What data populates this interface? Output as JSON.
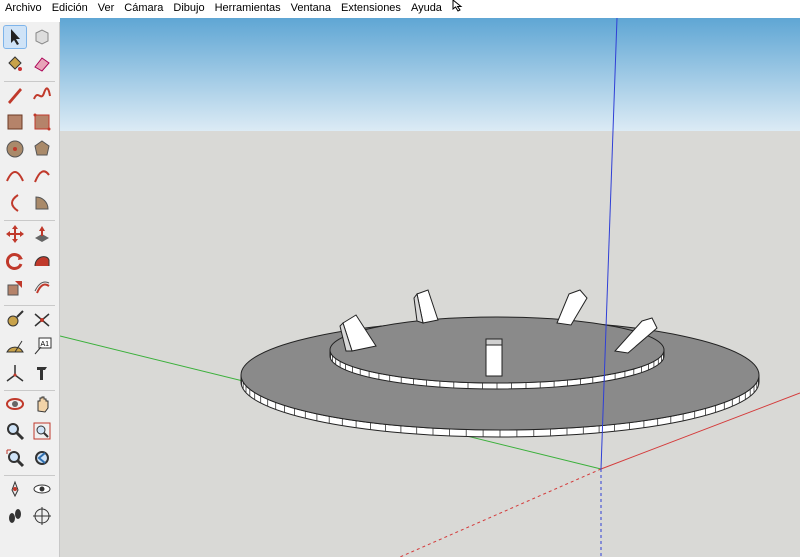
{
  "menu": [
    "Archivo",
    "Edición",
    "Ver",
    "Cámara",
    "Dibujo",
    "Herramientas",
    "Ventana",
    "Extensiones",
    "Ayuda"
  ],
  "colors": {
    "sky_top": "#5fa6d4",
    "sky_bottom": "#dcebf5",
    "ground": "#d9d9d6",
    "axis_red": "#d43b3b",
    "axis_green": "#3bb03b",
    "axis_blue": "#2f3fd6",
    "disc_face": "#8a8a8a",
    "disc_edge": "#ffffff"
  },
  "tools": [
    {
      "name": "select-tool-icon",
      "active": true
    },
    {
      "name": "component-tool-icon"
    },
    {
      "name": "paint-bucket-icon"
    },
    {
      "name": "eraser-icon"
    },
    {
      "name": "pencil-line-icon"
    },
    {
      "name": "freehand-icon"
    },
    {
      "name": "rectangle-icon"
    },
    {
      "name": "rotated-rectangle-icon"
    },
    {
      "name": "circle-icon"
    },
    {
      "name": "polygon-icon"
    },
    {
      "name": "arc-icon"
    },
    {
      "name": "two-point-arc-icon"
    },
    {
      "name": "three-point-arc-icon"
    },
    {
      "name": "pie-icon"
    },
    {
      "name": "move-icon"
    },
    {
      "name": "push-pull-icon"
    },
    {
      "name": "rotate-icon"
    },
    {
      "name": "follow-me-icon"
    },
    {
      "name": "scale-icon"
    },
    {
      "name": "offset-icon"
    },
    {
      "name": "tape-measure-icon"
    },
    {
      "name": "dimension-icon"
    },
    {
      "name": "protractor-icon"
    },
    {
      "name": "text-icon"
    },
    {
      "name": "axes-icon"
    },
    {
      "name": "3d-text-icon"
    },
    {
      "name": "orbit-icon"
    },
    {
      "name": "pan-icon"
    },
    {
      "name": "zoom-icon"
    },
    {
      "name": "zoom-window-icon"
    },
    {
      "name": "zoom-extents-icon"
    },
    {
      "name": "previous-view-icon"
    },
    {
      "name": "position-camera-icon"
    },
    {
      "name": "look-around-icon"
    },
    {
      "name": "walk-icon"
    },
    {
      "name": "section-plane-icon"
    }
  ]
}
